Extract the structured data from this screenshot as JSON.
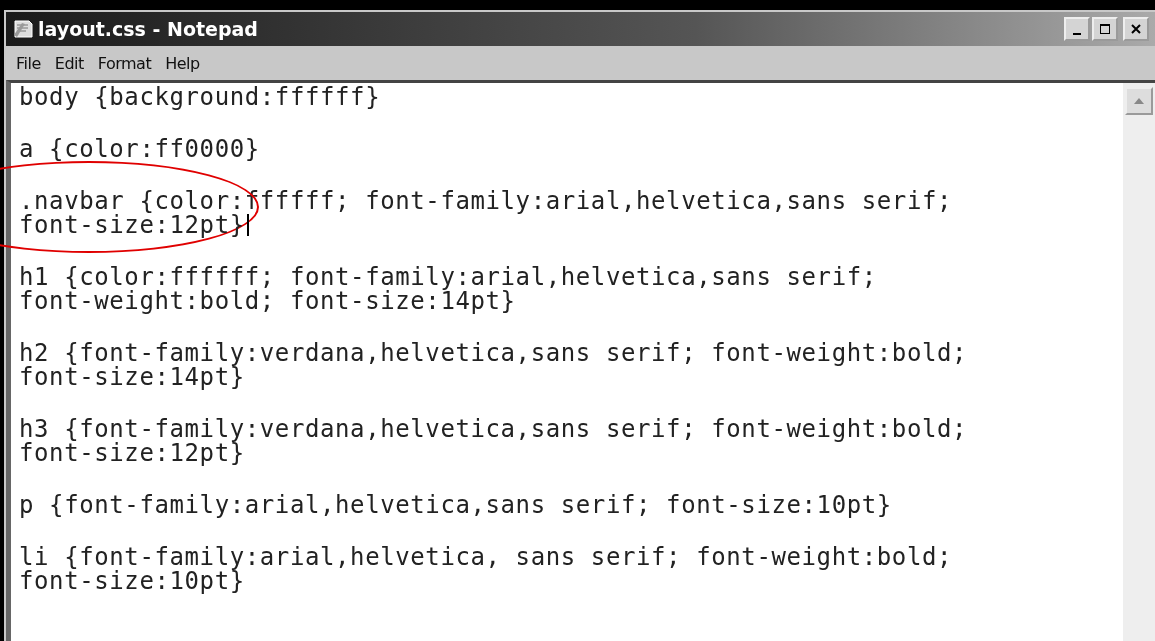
{
  "window": {
    "title": "layout.css - Notepad"
  },
  "menu": [
    "File",
    "Edit",
    "Format",
    "Help"
  ],
  "editor": {
    "paragraphs": [
      [
        {
          "text": "body {background:ffffff}",
          "caret": false
        }
      ],
      [
        {
          "text": "a {color:ff0000}",
          "caret": false
        }
      ],
      [
        {
          "text": ".navbar {color:ffffff; font-family:arial,helvetica,sans serif;",
          "caret": false,
          "circled": true
        },
        {
          "text": "font-size:12pt}",
          "caret": true
        }
      ],
      [
        {
          "text": "h1 {color:ffffff; font-family:arial,helvetica,sans serif;",
          "caret": false
        },
        {
          "text": "font-weight:bold; font-size:14pt}",
          "caret": false
        }
      ],
      [
        {
          "text": "h2 {font-family:verdana,helvetica,sans serif; font-weight:bold;",
          "caret": false
        },
        {
          "text": "font-size:14pt}",
          "caret": false
        }
      ],
      [
        {
          "text": "h3 {font-family:verdana,helvetica,sans serif; font-weight:bold;",
          "caret": false
        },
        {
          "text": "font-size:12pt}",
          "caret": false
        }
      ],
      [
        {
          "text": "p {font-family:arial,helvetica,sans serif; font-size:10pt}",
          "caret": false
        }
      ],
      [
        {
          "text": "li {font-family:arial,helvetica, sans serif; font-weight:bold;",
          "caret": false
        },
        {
          "text": "font-size:10pt}",
          "caret": false
        }
      ]
    ]
  }
}
